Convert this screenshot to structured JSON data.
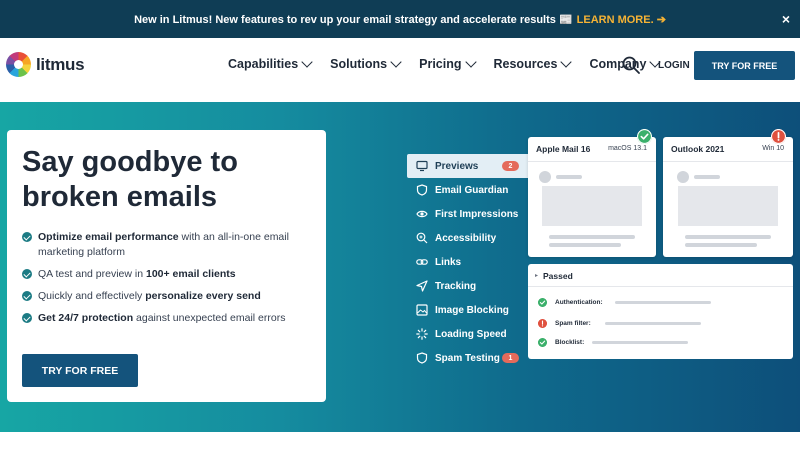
{
  "announcement": {
    "text": "New in Litmus! New features to rev up your email strategy and accelerate results 📰 ",
    "learn_more": "LEARN MORE. ➔",
    "close": "×"
  },
  "nav": {
    "logo_text": "litmus",
    "items": [
      {
        "label": "Capabilities"
      },
      {
        "label": "Solutions"
      },
      {
        "label": "Pricing"
      },
      {
        "label": "Resources"
      },
      {
        "label": "Company"
      }
    ],
    "login": "LOGIN",
    "try_free": "TRY FOR FREE"
  },
  "hero": {
    "title": "Say goodbye to broken emails",
    "features": [
      {
        "bold_before": "Optimize email performance",
        "text": " with an all-in-one email marketing platform",
        "bold_after": ""
      },
      {
        "bold_before": "",
        "text": "QA test and preview in ",
        "bold_after": "100+ email clients"
      },
      {
        "bold_before": "",
        "text": "Quickly and effectively ",
        "bold_after": "personalize every send"
      },
      {
        "bold_before": "Get 24/7 protection",
        "text": " against unexpected email errors",
        "bold_after": ""
      }
    ],
    "cta": "TRY FOR FREE"
  },
  "feature_list": [
    {
      "label": "Previews",
      "icon": "monitor-icon",
      "badge": "2",
      "active": true
    },
    {
      "label": "Email Guardian",
      "icon": "shield-icon",
      "badge": "",
      "active": false
    },
    {
      "label": "First Impressions",
      "icon": "eye-icon",
      "badge": "",
      "active": false
    },
    {
      "label": "Accessibility",
      "icon": "zoom-icon",
      "badge": "",
      "active": false
    },
    {
      "label": "Links",
      "icon": "link-icon",
      "badge": "",
      "active": false
    },
    {
      "label": "Tracking",
      "icon": "send-icon",
      "badge": "",
      "active": false
    },
    {
      "label": "Image Blocking",
      "icon": "image-icon",
      "badge": "",
      "active": false
    },
    {
      "label": "Loading Speed",
      "icon": "loader-icon",
      "badge": "",
      "active": false
    },
    {
      "label": "Spam Testing",
      "icon": "shield-icon",
      "badge": "1",
      "active": false
    }
  ],
  "previews": [
    {
      "client": "Apple Mail 16",
      "version": "macOS 13.1",
      "status": "ok"
    },
    {
      "client": "Outlook 2021",
      "version": "Win 10",
      "status": "error"
    }
  ],
  "checks": {
    "title": "Passed",
    "rows": [
      {
        "label": "Authentication:",
        "status": "ok"
      },
      {
        "label": "Spam filter:",
        "status": "error"
      },
      {
        "label": "Blocklist:",
        "status": "ok"
      }
    ]
  },
  "colors": {
    "accent": "#14537c",
    "announcement_bg": "#0f3d55",
    "learn_more": "#f5b335",
    "ok": "#3bb06b",
    "error": "#e0513f"
  }
}
